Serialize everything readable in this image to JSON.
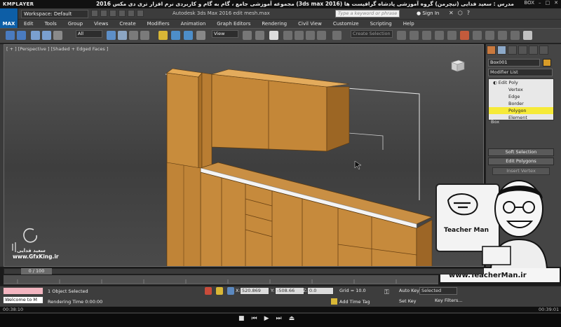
{
  "kmplayer": {
    "logo": "KMPLAYER",
    "title": "مجموعه آموزشی جامع ، گام به گام و کاربردی نرم افزار تری دی مکس 2016 (3ds max 2016)  مدرس : سعید فدایی (تیچرمن) گروه آموزشی پادشاه گرافیست ها",
    "right_label": "BOX"
  },
  "titlebar": {
    "max_logo": "MAX",
    "workspace": "Workspace: Default",
    "app_title": "Autodesk 3ds Max 2016      edit mesh.max",
    "search_placeholder": "Type a keyword or phrase",
    "sign_in": "Sign In"
  },
  "menu": [
    "Edit",
    "Tools",
    "Group",
    "Views",
    "Create",
    "Modifiers",
    "Animation",
    "Graph Editors",
    "Rendering",
    "Civil View",
    "Customize",
    "Scripting",
    "Help"
  ],
  "toolbar": {
    "selection_filter": "All",
    "reference_coord": "View",
    "named_selection_placeholder": "Create Selection Se"
  },
  "viewport": {
    "label": "[ + ] [Perspective ] [Shaded + Edged Faces ]"
  },
  "command_panel": {
    "object_name": "Box001",
    "modifier_list": "Modifier List",
    "stack": [
      "Edit Poly",
      "Vertex",
      "Edge",
      "Border",
      "Polygon",
      "Element"
    ],
    "selected_stack_item": "Polygon",
    "base_object": "Box",
    "rollouts": {
      "soft_selection": "Soft Selection",
      "edit_polygons": "Edit Polygons",
      "insert_vertex": "Insert Vertex"
    }
  },
  "overlay": {
    "teacher_name": "Teacher Man",
    "website": "www.TeacherMan.ir",
    "gfx_name": "سعید فدایی",
    "gfx_site": "www.GfxKing.ir"
  },
  "timeline": {
    "frame": "0 / 100"
  },
  "status": {
    "selection": "1 Object Selected",
    "render_time": "Rendering Time  0:00:00",
    "welcome": "Welcome to M",
    "x_label": "X:",
    "x_value": "520.869",
    "y_label": "Y:",
    "y_value": "-508.66",
    "z_label": "Z:",
    "z_value": "0.0",
    "grid": "Grid = 10.0",
    "add_time_tag": "Add Time Tag",
    "auto_key": "Auto Key",
    "set_key": "Set Key",
    "key_selection": "Selected",
    "key_filters": "Key Filters..."
  },
  "player": {
    "time_elapsed": "00:38:10",
    "time_total": "00:39:01"
  },
  "colors": {
    "cabinet": "#c88c3c",
    "selected_stack": "#f6ea38",
    "max_blue": "#0d5ea6"
  }
}
